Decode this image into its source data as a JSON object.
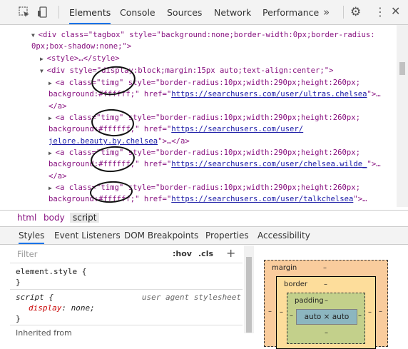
{
  "toolbar": {
    "tabs": [
      "Elements",
      "Console",
      "Sources",
      "Network",
      "Performance"
    ],
    "more": "»",
    "inspect_icon": "inspect-element-icon",
    "device_icon": "device-toolbar-icon",
    "settings_icon": "gear-icon",
    "menu_icon": "kebab-menu-icon",
    "close_icon": "close-icon"
  },
  "code": {
    "l1": "<div class=\"tagbox\" style=\"background:none;border-width:0px;border-radius:",
    "l2": "0px;box-shadow:none;\">",
    "l3": "<style>…</style>",
    "l4": "<div style=\"display:block;margin:15px auto;text-align:center;\">",
    "a1_1": "<a class=\"timg\" style=\"border-radius:10px;width:290px;height:260px;",
    "a1_2a": "background:#ffffff;\" href=\"",
    "a1_link": "https://searchusers.com/user/ultras.chelsea",
    "a1_2b": "\">…",
    "a1_3": "</a>",
    "a2_1": "<a class=\"timg\" style=\"border-radius:10px;width:290px;height:260px;",
    "a2_2a": "background:#ffffff;\" href=\"",
    "a2_link1": "https://searchusers.com/user/",
    "a2_link2": "jelore.beauty.by.chelsea",
    "a2_3b": "\">…</a>",
    "a3_1": "<a class=\"timg\" style=\"border-radius:10px;width:290px;height:260px;",
    "a3_2a": "background:#ffffff;\" href=\"",
    "a3_link": "https://searchusers.com/user/chelsea.wilde_",
    "a3_2b": "\">…",
    "a3_3": "</a>",
    "a4_1": "<a class=\"timg\" style=\"border-radius:10px;width:290px;height:260px;",
    "a4_2a": "background:#ffffff;\" href=\"",
    "a4_link": "https://searchusers.com/user/talkchelsea",
    "a4_2b": "\">…"
  },
  "breadcrumb": [
    "html",
    "body",
    "script"
  ],
  "lower_tabs": [
    "Styles",
    "Event Listeners",
    "DOM Breakpoints",
    "Properties",
    "Accessibility"
  ],
  "styles": {
    "filter_placeholder": "Filter",
    "hov": ":hov",
    "cls": ".cls",
    "plus": "+",
    "element_style": "element.style {",
    "close_brace": "}",
    "script_selector": "script {",
    "ua_label": "user agent stylesheet",
    "prop_name": "display",
    "prop_value": "none;",
    "inherited": "Inherited from"
  },
  "box_model": {
    "margin_label": "margin",
    "border_label": "border",
    "padding_label": "padding",
    "content": "auto × auto",
    "dash": "–"
  }
}
